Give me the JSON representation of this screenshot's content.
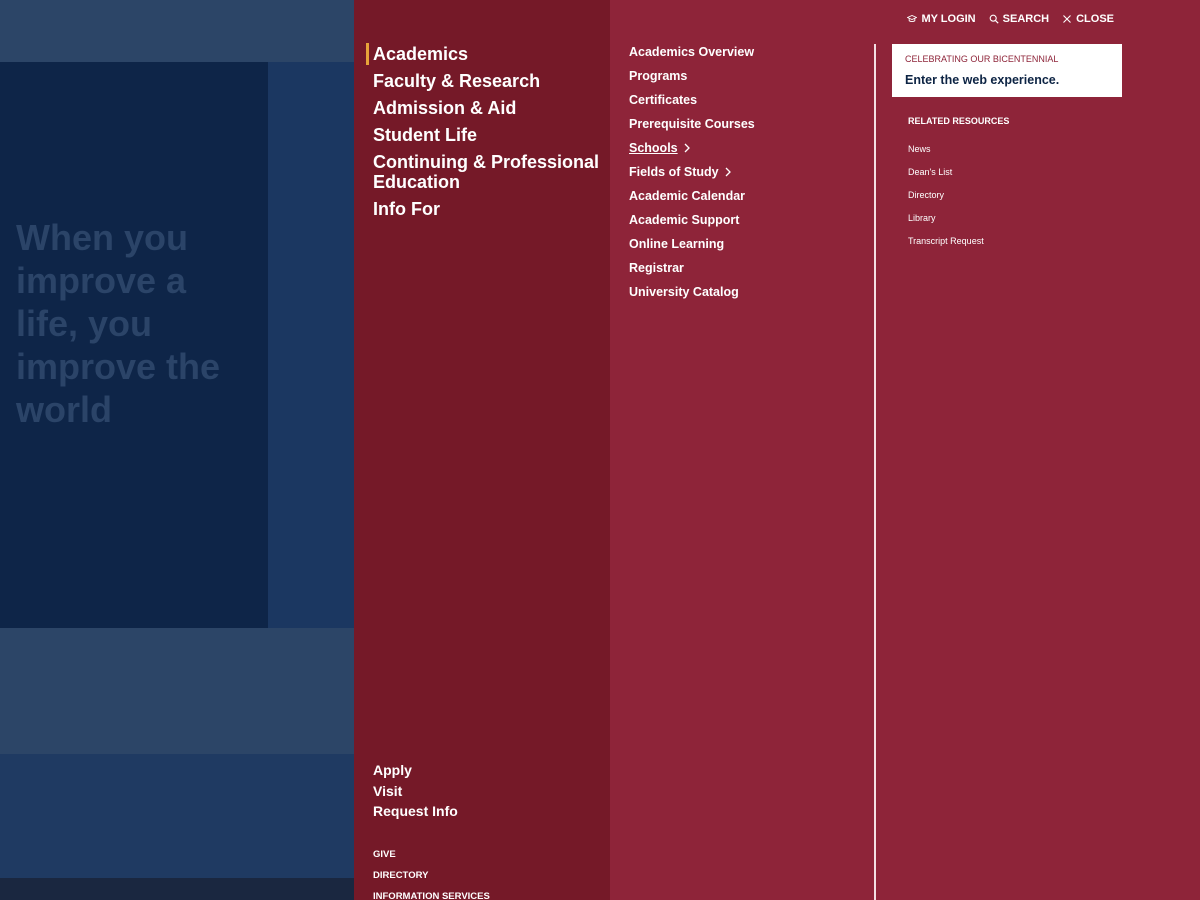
{
  "background_page": {
    "hero_title": "When you improve a life, you improve the world"
  },
  "utility_nav": {
    "items": [
      {
        "label": "MY LOGIN",
        "icon": "graduation-cap-icon"
      },
      {
        "label": "SEARCH",
        "icon": "search-icon"
      },
      {
        "label": "CLOSE",
        "icon": "close-icon"
      }
    ]
  },
  "primary_nav": {
    "active": "Academics",
    "items": [
      {
        "label": "Academics"
      },
      {
        "label": "Faculty & Research"
      },
      {
        "label": "Admission & Aid"
      },
      {
        "label": "Student Life"
      },
      {
        "label": "Continuing & Professional Education"
      },
      {
        "label": "Info For"
      }
    ]
  },
  "action_links": {
    "items": [
      {
        "label": "Apply"
      },
      {
        "label": "Visit"
      },
      {
        "label": "Request Info"
      }
    ]
  },
  "utility_links": {
    "items": [
      {
        "label": "GIVE"
      },
      {
        "label": "DIRECTORY"
      },
      {
        "label": "INFORMATION SERVICES"
      }
    ]
  },
  "secondary_nav": {
    "items": [
      {
        "label": "Academics Overview"
      },
      {
        "label": "Programs"
      },
      {
        "label": "Certificates"
      },
      {
        "label": "Prerequisite Courses"
      },
      {
        "label": "Schools",
        "has_submenu": true,
        "current": true
      },
      {
        "label": "Fields of Study",
        "has_submenu": true
      },
      {
        "label": "Academic Calendar"
      },
      {
        "label": "Academic Support"
      },
      {
        "label": "Online Learning"
      },
      {
        "label": "Registrar"
      },
      {
        "label": "University Catalog"
      }
    ]
  },
  "promo": {
    "eyebrow": "CELEBRATING OUR BICENTENNIAL",
    "title": "Enter the web experience."
  },
  "related_resources": {
    "heading": "RELATED RESOURCES",
    "items": [
      {
        "label": "News"
      },
      {
        "label": "Dean's List"
      },
      {
        "label": "Directory"
      },
      {
        "label": "Library"
      },
      {
        "label": "Transcript Request"
      }
    ]
  },
  "colors": {
    "primary_panel": "#751928",
    "secondary_panel": "#8e2439",
    "accent": "#e8a33a",
    "navy": "#0d2444"
  }
}
